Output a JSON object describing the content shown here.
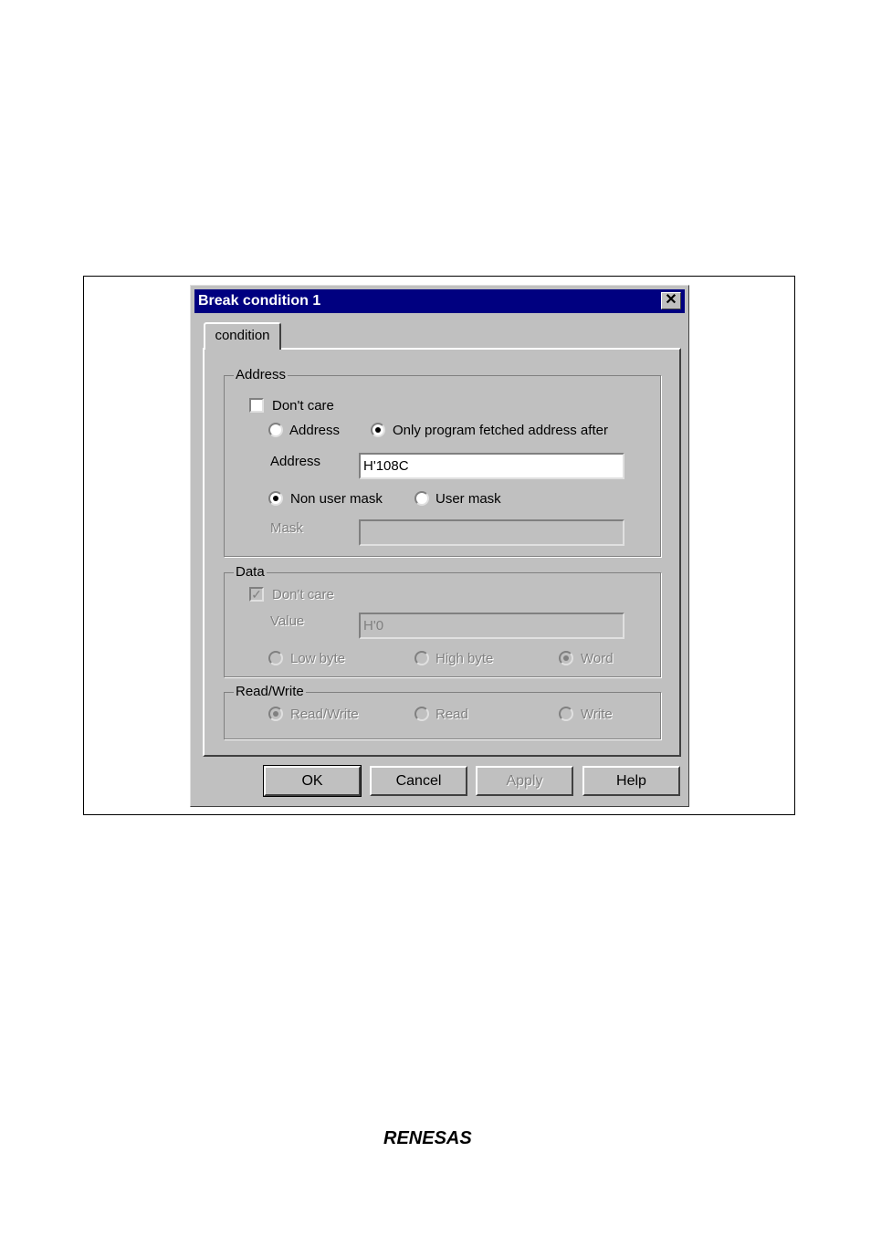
{
  "dialog": {
    "title": "Break condition 1",
    "close_symbol": "✕",
    "tab_label": "condition"
  },
  "address_group": {
    "legend": "Address",
    "dont_care_label": "Don't care",
    "dont_care_checked": false,
    "radio_address_label": "Address",
    "radio_fetched_label": "Only program fetched address after",
    "selected": "fetched",
    "address_field_label": "Address",
    "address_value": "H'108C",
    "radio_non_user_mask_label": "Non user mask",
    "radio_user_mask_label": "User mask",
    "mask_selected": "non_user_mask",
    "mask_field_label": "Mask",
    "mask_value": ""
  },
  "data_group": {
    "legend": "Data",
    "dont_care_label": "Don't care",
    "dont_care_checked": true,
    "value_label": "Value",
    "value_value": "H'0",
    "low_byte_label": "Low byte",
    "high_byte_label": "High byte",
    "word_label": "Word",
    "selected": "word"
  },
  "rw_group": {
    "legend": "Read/Write",
    "read_write_label": "Read/Write",
    "read_label": "Read",
    "write_label": "Write",
    "selected": "read_write"
  },
  "buttons": {
    "ok": "OK",
    "cancel": "Cancel",
    "apply": "Apply",
    "help": "Help"
  },
  "footer": {
    "logo_text": "RENESAS"
  },
  "colors": {
    "titlebar": "#000080",
    "dialog_face": "#c0c0c0"
  }
}
